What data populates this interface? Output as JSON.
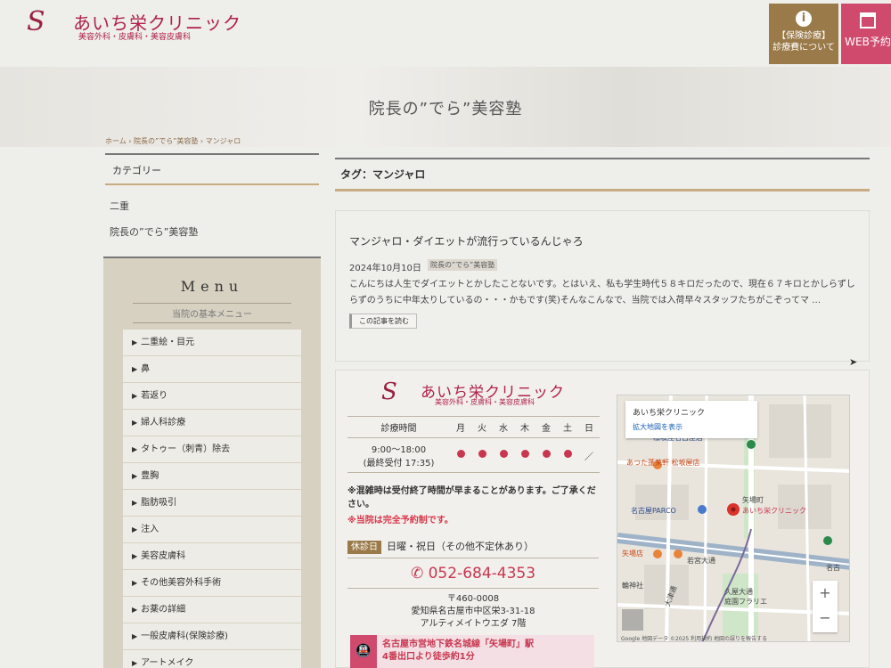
{
  "header": {
    "logo_script": "S",
    "logo_name": "あいち栄クリニック",
    "logo_sub": "美容外科・皮膚科・美容皮膚科",
    "insurance_icon": "info-icon",
    "insurance_btn_line1": "【保険診療】",
    "insurance_btn_line2": "診療費について",
    "web_btn": "WEB予約",
    "web_icon": "calendar-icon",
    "accent_brown": "#9a7a48",
    "accent_pink": "#d04a6e"
  },
  "hero": {
    "title": "院長の”でら”美容塾"
  },
  "breadcrumb": {
    "text": "ホーム › 院長の”でら”美容塾 › マンジャロ"
  },
  "sidebar": {
    "category_title": "カテゴリー",
    "categories": [
      "二重",
      "院長の”でら”美容塾"
    ],
    "menu_title": "Menu",
    "menu_subtitle": "当院の基本メニュー",
    "menu_items": [
      "二重絵・目元",
      "鼻",
      "若返り",
      "婦人科診療",
      "タトゥー（刺青）除去",
      "豊胸",
      "脂肪吸引",
      "注入",
      "美容皮膚科",
      "その他美容外科手術",
      "お薬の詳細",
      "一般皮膚科(保険診療)",
      "アートメイク"
    ]
  },
  "main": {
    "tag_heading": "タグ：マンジャロ",
    "post": {
      "title": "マンジャロ・ダイエットが流行っているんじゃろ",
      "date": "2024年10月10日",
      "category": "院長の”でら”美容塾",
      "excerpt": "こんにちは人生でダイエットとかしたことないです。とはいえ、私も学生時代５８キロだったので、現在６７キロとかしらずしらずのうちに中年太りしているの・・・かもです(笑)そんなこんなで、当院では入荷早々スタッフたちがこぞってマ …",
      "read_more": "この記事を読む"
    },
    "clinic": {
      "logo_name": "あいち栄クリニック",
      "logo_sub": "美容外科・皮膚科・美容皮膚科",
      "hours_label": "診療時間",
      "days": [
        "月",
        "火",
        "水",
        "木",
        "金",
        "土",
        "日"
      ],
      "hours_line1": "9:00〜18:00",
      "hours_line2": "(最終受付 17:35)",
      "open_days": [
        true,
        true,
        true,
        true,
        true,
        true,
        false
      ],
      "closed_mark": "／",
      "note1": "※混雑時は受付終了時間が早まることがあります。ご了承ください。",
      "note2": "※当院は完全予約制です。",
      "closed_badge": "休診日",
      "closed_text": "日曜・祝日（その他不定休あり）",
      "phone_icon": "phone-icon",
      "phone": "052-684-4353",
      "postal": "〒460-0008",
      "address1": "愛知県名古屋市中区栄3-31-18",
      "address2": "アルティメイトウエダ 7階",
      "access_icon": "train-icon",
      "access_line1": "名古屋市営地下鉄名城線「矢場町」駅",
      "access_line2": "4番出口より徒歩約1分"
    },
    "map": {
      "card_title": "あいち栄クリニック",
      "card_link": "拡大地図を表示",
      "labels": {
        "l1": "松坂屋名古屋店",
        "l2": "あつた蓬莱軒 松坂屋店",
        "l3": "矢場町",
        "l4": "あいち栄クリニック",
        "l5": "名古屋PARCO",
        "l6": "矢場店",
        "l7": "若宮大通",
        "l8": "名古",
        "l9": "大津通",
        "l10": "久屋大通",
        "l11": "庭園フラリエ",
        "l12": "輪神社"
      },
      "zoom_in": "+",
      "zoom_out": "−",
      "footer": "Google  地図データ ©2025  利用規約  地図の誤りを報告する"
    }
  }
}
